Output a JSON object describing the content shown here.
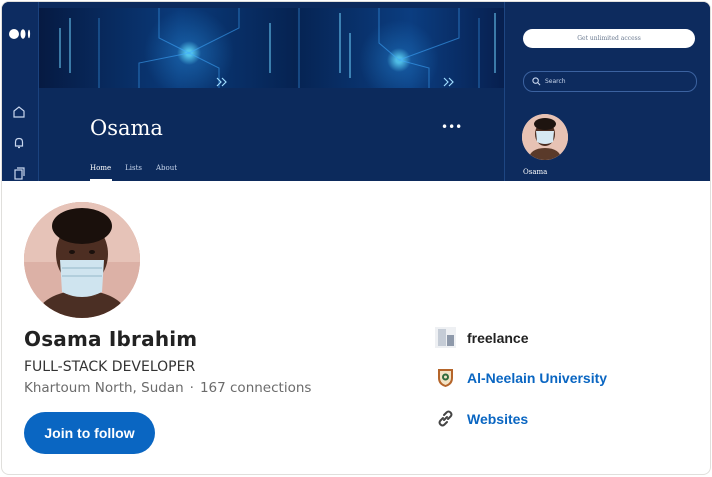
{
  "banner": {
    "medium_profile_name": "Osama",
    "more_label": "•••",
    "tabs": [
      "Home",
      "Lists",
      "About"
    ],
    "unlimited_access_label": "Get unlimited access",
    "search_label": "Search",
    "side_name": "Osama"
  },
  "profile": {
    "name": "Osama Ibrahim",
    "headline": "FULL-STACK DEVELOPER",
    "location": "Khartoum North, Sudan",
    "separator": "·",
    "connections": "167 connections",
    "join_button_label": "Join to follow"
  },
  "details": [
    {
      "label": "freelance",
      "icon": "company-logo-icon",
      "style": "dark"
    },
    {
      "label": "Al-Neelain University",
      "icon": "university-crest-icon",
      "style": "link"
    },
    {
      "label": "Websites",
      "icon": "link-icon",
      "style": "link"
    }
  ],
  "colors": {
    "primary": "#0a66c2",
    "banner_bg": "#0c2a5c"
  }
}
